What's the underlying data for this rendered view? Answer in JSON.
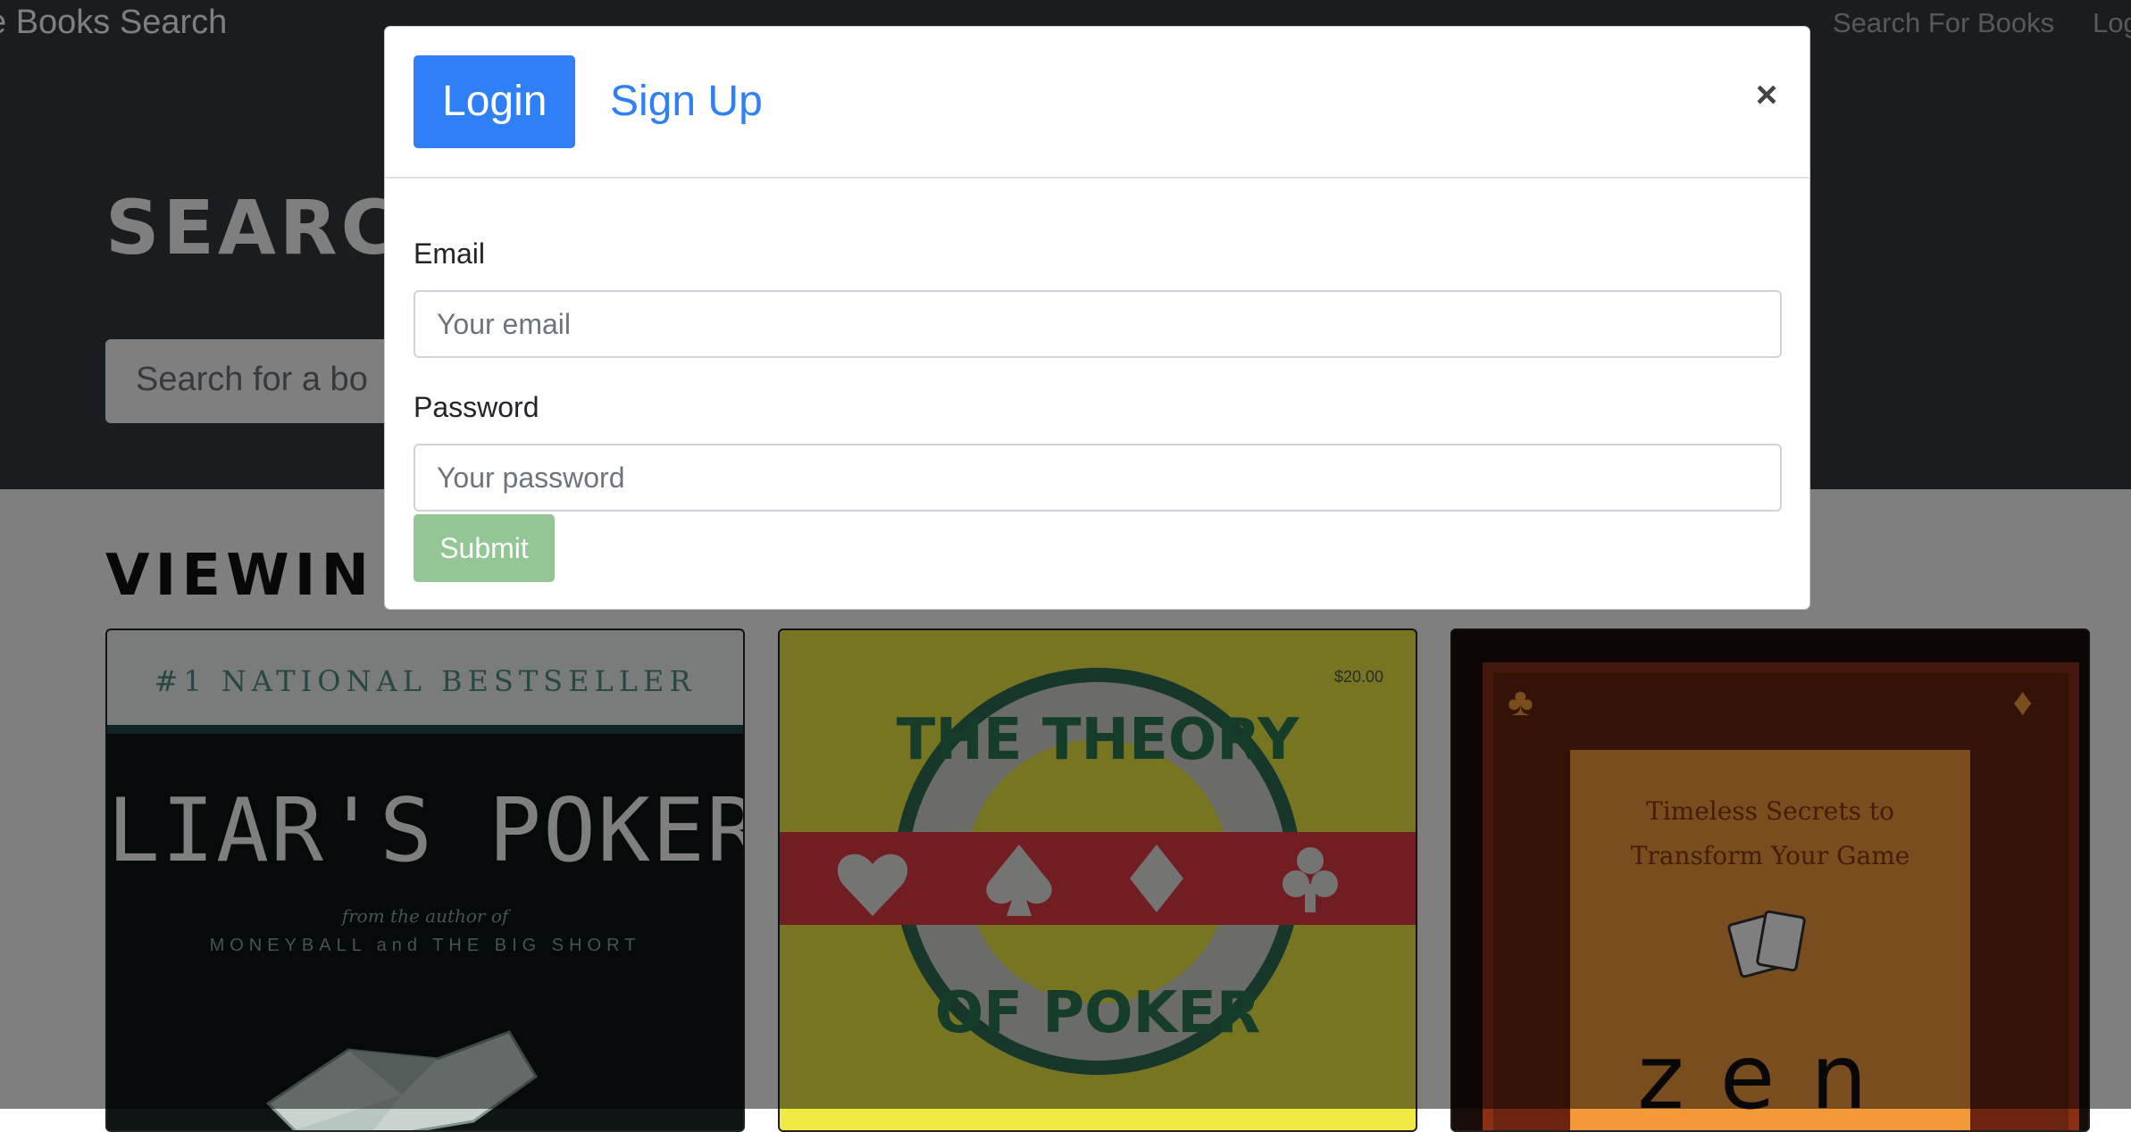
{
  "navbar": {
    "brand": "e Books Search",
    "links": [
      "Search For Books",
      "Log"
    ]
  },
  "jumbotron": {
    "title": "SEARC",
    "search_placeholder": "Search for a bo"
  },
  "results": {
    "heading": "VIEWIN",
    "books": [
      {
        "bestseller": "#1 NATIONAL BESTSELLER",
        "title": "LIAR'S POKER",
        "subtitle_line1": "from the author of",
        "subtitle_line2": "MONEYBALL and THE BIG SHORT"
      },
      {
        "price": "$20.00",
        "title_top": "THE THEORY",
        "title_bottom": "OF POKER"
      },
      {
        "subtitle_line1": "Timeless Secrets to",
        "subtitle_line2": "Transform Your Game",
        "title": "zen"
      }
    ]
  },
  "modal": {
    "tabs": [
      {
        "label": "Login",
        "active": true
      },
      {
        "label": "Sign Up",
        "active": false
      }
    ],
    "close_symbol": "×",
    "email_label": "Email",
    "email_placeholder": "Your email",
    "password_label": "Password",
    "password_placeholder": "Your password",
    "submit_label": "Submit"
  },
  "colors": {
    "primary": "#2f7ff7",
    "submit_disabled": "#94c695",
    "navbar": "#343a40"
  },
  "icons": [
    "close-icon",
    "heart-suit-icon",
    "spade-suit-icon",
    "diamond-suit-icon",
    "club-suit-icon",
    "playing-cards-icon"
  ]
}
